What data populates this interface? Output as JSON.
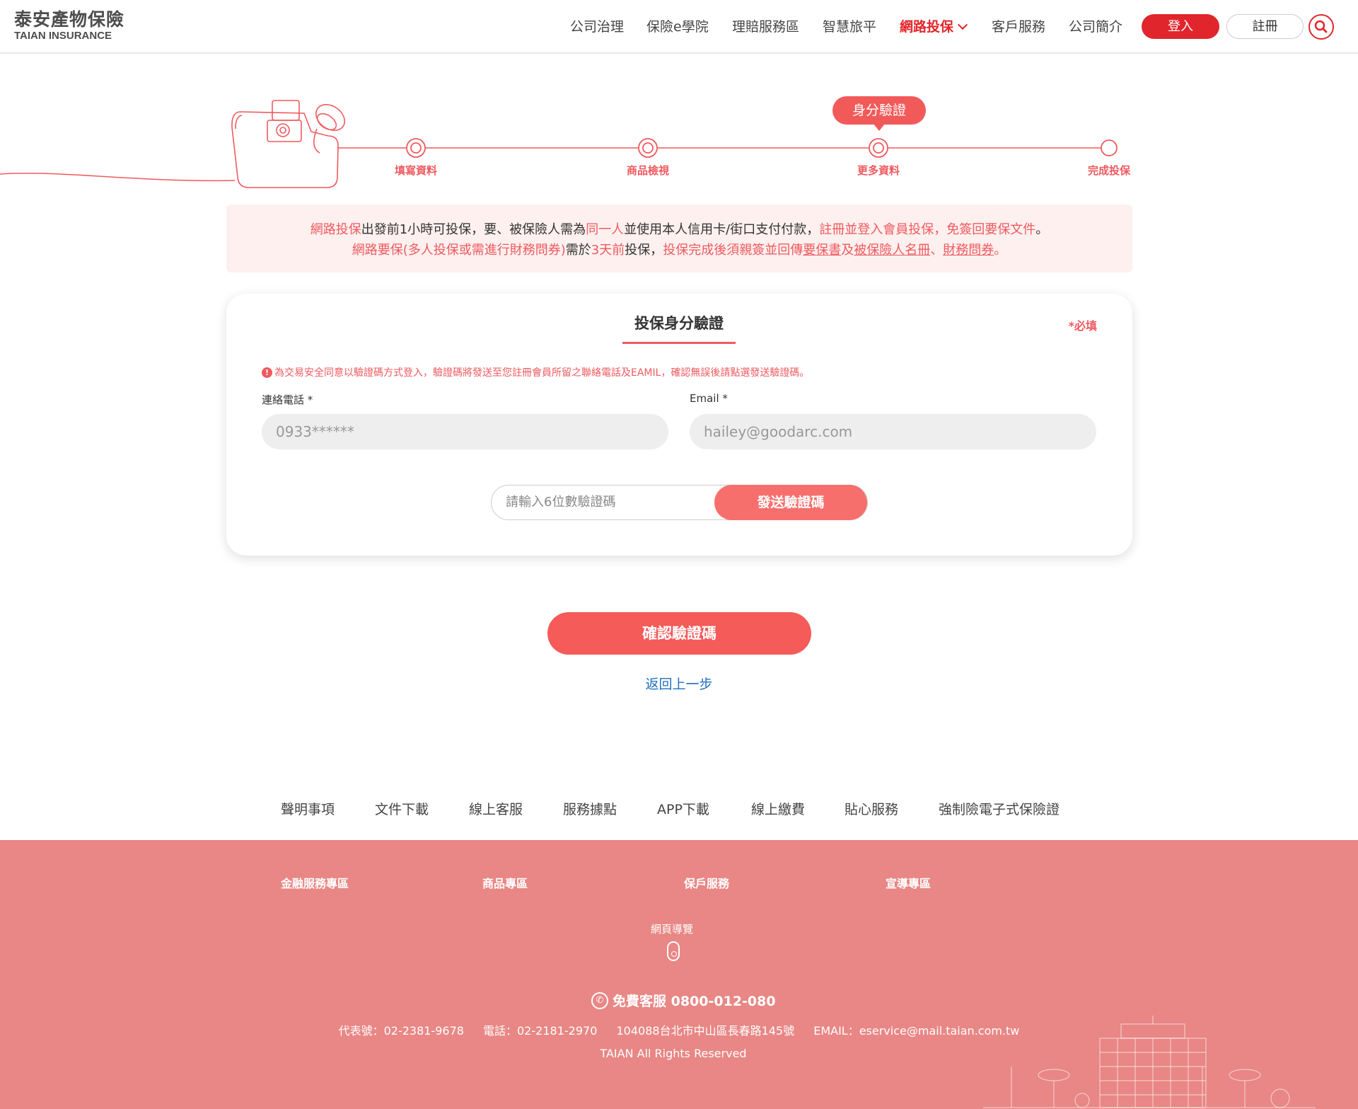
{
  "brand": {
    "name_zh": "泰安產物保險",
    "name_en": "TAIAN INSURANCE"
  },
  "nav": {
    "items": [
      "公司治理",
      "保險e學院",
      "理賠服務區",
      "智慧旅平",
      "網路投保",
      "客戶服務",
      "公司簡介"
    ],
    "active": "網路投保",
    "login": "登入",
    "register": "註冊",
    "search_icon": "search-icon"
  },
  "steps": {
    "current_badge": "身分驗證",
    "labels": [
      "填寫資料",
      "商品檢視",
      "更多資料",
      "完成投保"
    ]
  },
  "notice": {
    "l1a": "網路投保",
    "l1b": "出發前1小時可投保，要、被保險人需為",
    "l1c": "同一人",
    "l1d": "並使用本人信用卡/街口支付付款，",
    "l1e": "註冊並登入會員投保",
    "l1f": "，",
    "l1g": "免簽回要保文件",
    "l1h": "。",
    "l2a": "網路要保(多人投保或需進行財務問券)",
    "l2b": "需於",
    "l2c": "3天前",
    "l2d": "投保，",
    "l2e": "投保完成後須親簽並回傳",
    "l2f": "要保書",
    "l2g": "及",
    "l2h": "被保險人名冊",
    "l2i": "、",
    "l2j": "財務問券",
    "l2k": "。"
  },
  "card": {
    "title": "投保身分驗證",
    "required": "*必填",
    "warning_icon": "!",
    "warning": "為交易安全同意以驗證碼方式登入，驗證碼將發送至您註冊會員所留之聯絡電話及EAMIL，確認無誤後請點選發送驗證碼。",
    "phone_label": "連絡電話 *",
    "phone_value": "0933******",
    "email_label": "Email *",
    "email_value": "hailey@goodarc.com",
    "code_placeholder": "請輸入6位數驗證碼",
    "send_button": "發送驗證碼"
  },
  "confirm_button": "確認驗證碼",
  "back_link": "返回上一步",
  "footer_links": [
    "聲明事項",
    "文件下載",
    "線上客服",
    "服務據點",
    "APP下載",
    "線上繳費",
    "貼心服務",
    "強制險電子式保險證"
  ],
  "footer": {
    "categories": [
      "金融服務專區",
      "商品專區",
      "保戶服務",
      "宣導專區"
    ],
    "sitemap": "網頁導覽",
    "hotline": "免費客服 0800-012-080",
    "main_phone": "代表號：02-2381-9678",
    "phone": "電話：02-2181-2970",
    "address": "104088台北市中山區長春路145號",
    "email": "EMAIL：eservice@mail.taian.com.tw",
    "copyright": "TAIAN All Rights Reserved"
  },
  "colors": {
    "primary": "#e0262c",
    "accent": "#f45b59",
    "footer_bg": "#e88785",
    "notice_bg": "#fdf0ef"
  }
}
